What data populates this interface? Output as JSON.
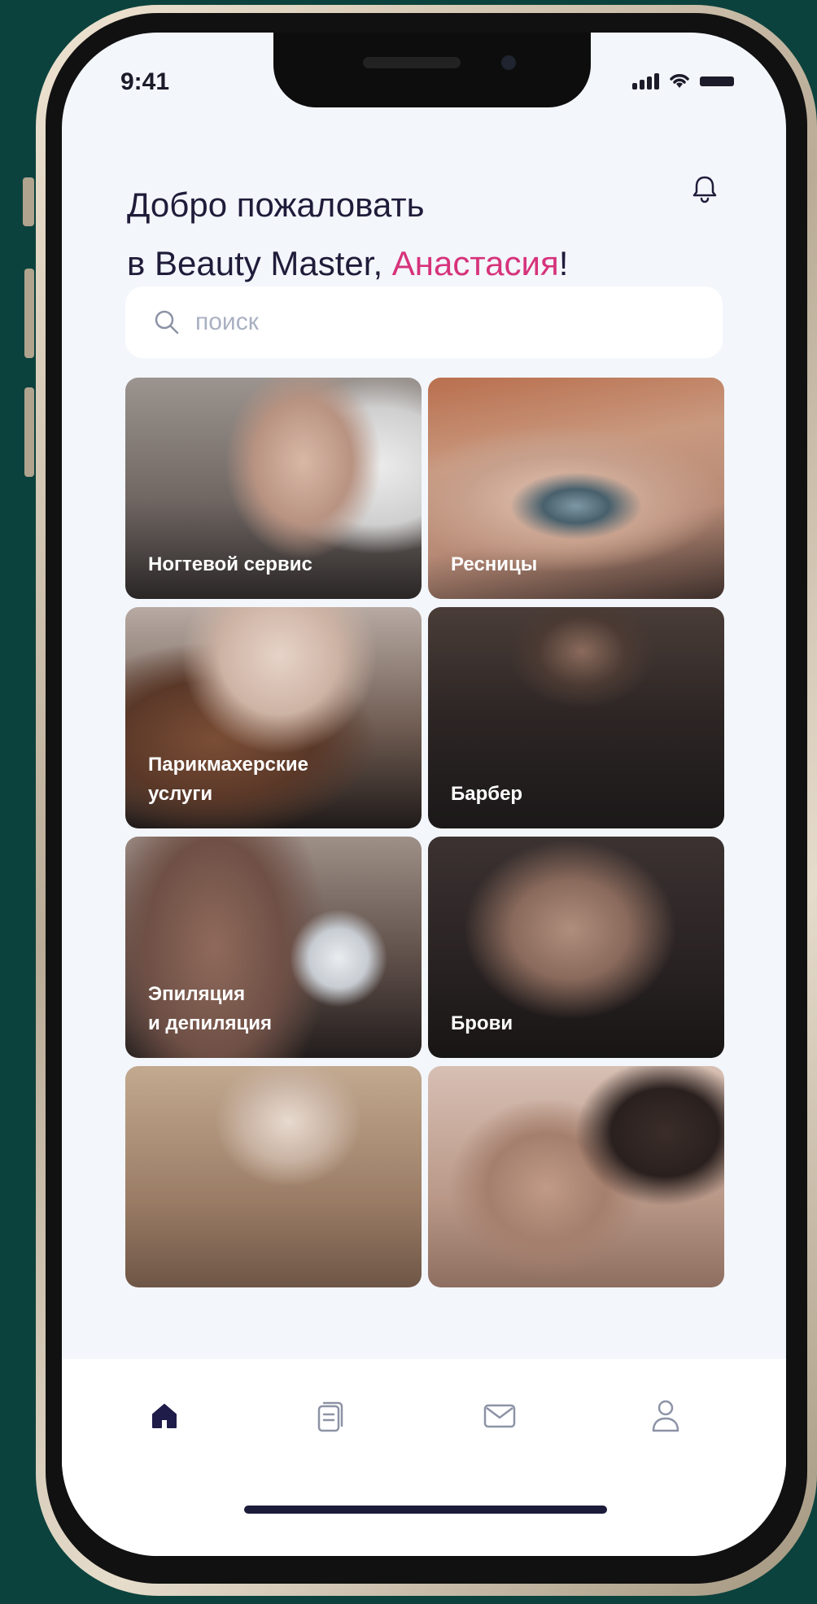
{
  "status_bar": {
    "time": "9:41"
  },
  "header": {
    "greeting_line1": "Добро пожаловать",
    "greeting_line2_prefix": "в Beauty Master, ",
    "user_name": "Анастасия",
    "greeting_suffix": "!"
  },
  "search": {
    "placeholder": "поиск"
  },
  "categories": [
    {
      "label_line1": "Ногтевой сервис",
      "label_line2": ""
    },
    {
      "label_line1": "Ресницы",
      "label_line2": ""
    },
    {
      "label_line1": "Парикмахерские",
      "label_line2": "услуги"
    },
    {
      "label_line1": "Барбер",
      "label_line2": ""
    },
    {
      "label_line1": "Эпиляция",
      "label_line2": "и депиляция"
    },
    {
      "label_line1": "Брови",
      "label_line2": ""
    }
  ],
  "tabs": [
    {
      "icon": "home-icon",
      "active": true
    },
    {
      "icon": "document-icon",
      "active": false
    },
    {
      "icon": "mail-icon",
      "active": false
    },
    {
      "icon": "profile-icon",
      "active": false
    }
  ],
  "colors": {
    "accent": "#d6337b",
    "active_tab": "#1f1c4a",
    "inactive_tab": "#8d93a6",
    "background": "#0c423d"
  }
}
